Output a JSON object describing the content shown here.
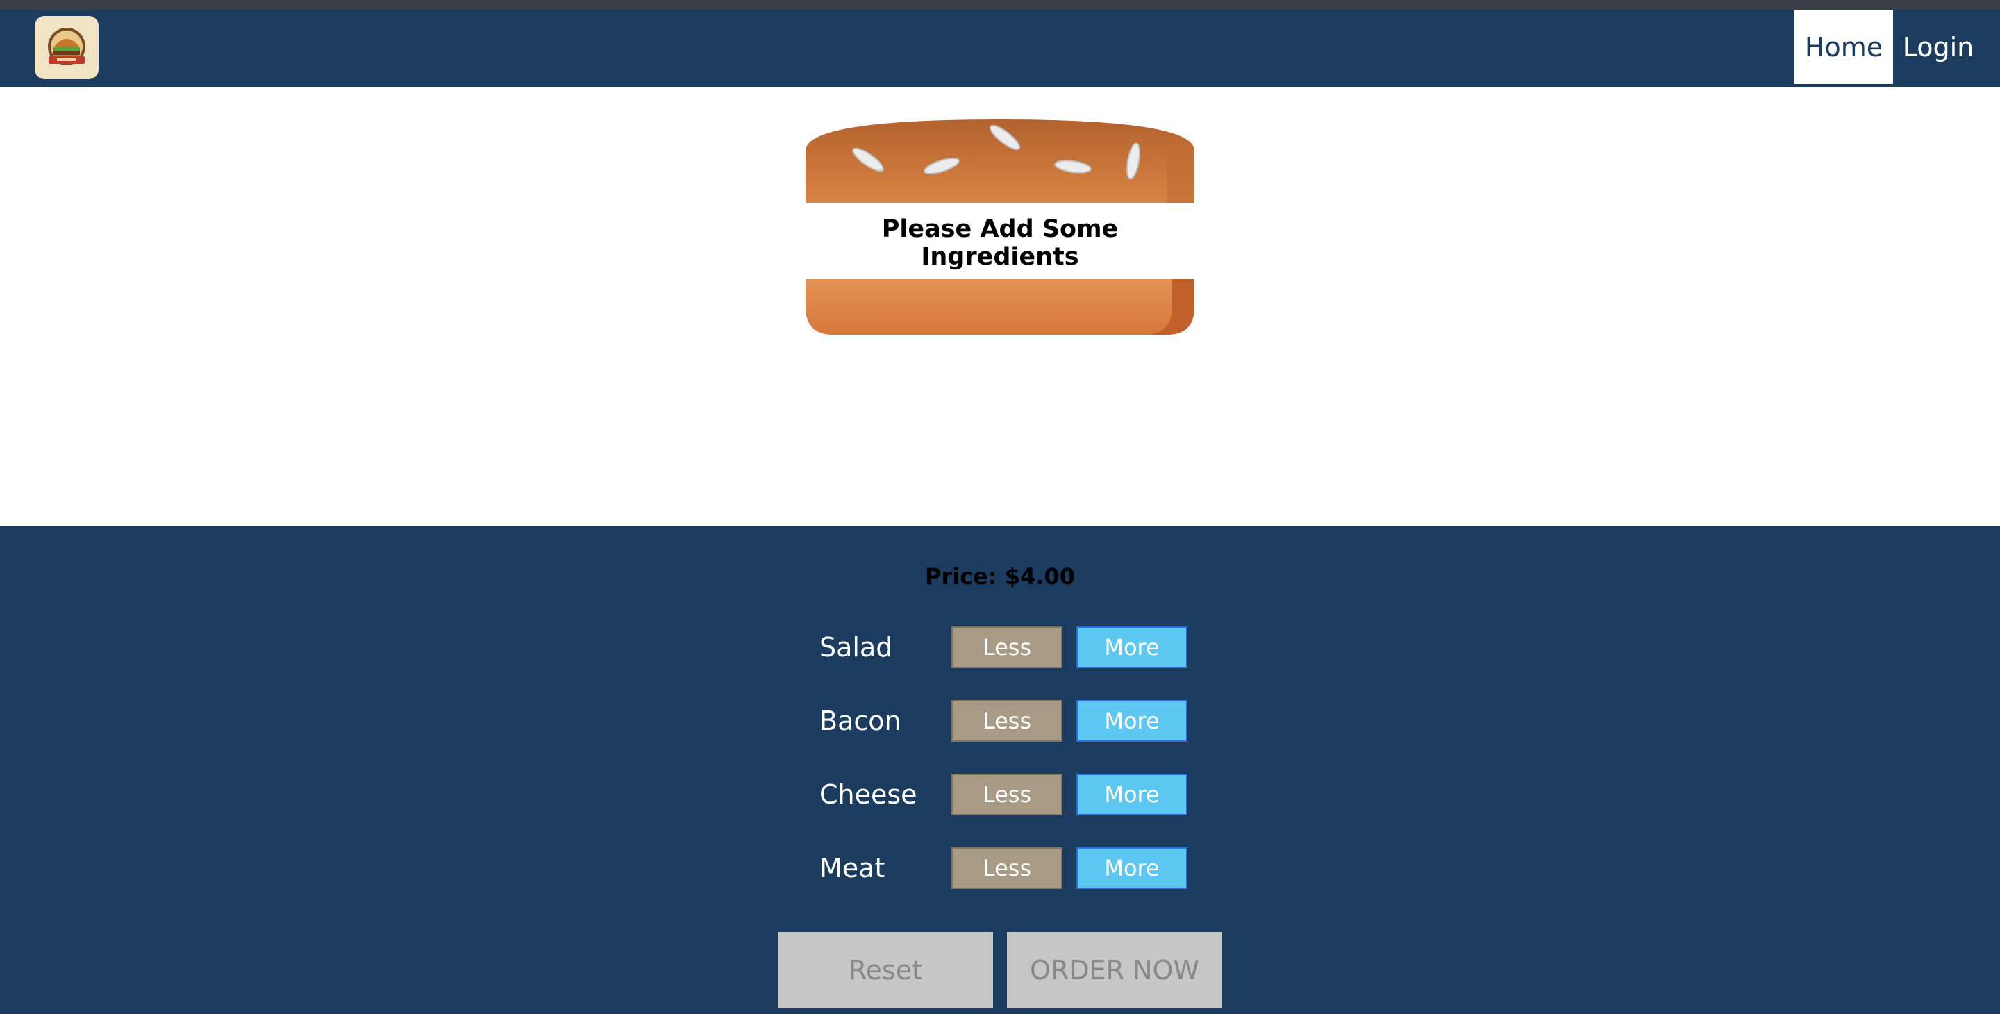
{
  "nav": {
    "home_label": "Home",
    "login_label": "Login"
  },
  "burger": {
    "message": "Please Add Some Ingredients"
  },
  "controls": {
    "price_label": "Price: $4.00",
    "ingredients": [
      {
        "label": "Salad",
        "less": "Less",
        "more": "More"
      },
      {
        "label": "Bacon",
        "less": "Less",
        "more": "More"
      },
      {
        "label": "Cheese",
        "less": "Less",
        "more": "More"
      },
      {
        "label": "Meat",
        "less": "Less",
        "more": "More"
      }
    ],
    "reset_label": "Reset",
    "order_label": "ORDER NOW"
  },
  "colors": {
    "header_bg": "#1b3c5e",
    "less_btn": "#a89a84",
    "more_btn": "#5cc8f1",
    "disabled_btn": "#c6c6c6"
  },
  "icons": {
    "logo": "burger-logo-icon"
  }
}
